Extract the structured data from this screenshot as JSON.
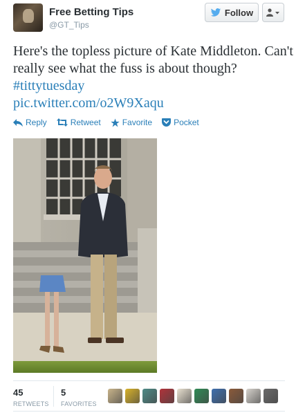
{
  "account": {
    "name": "Free Betting Tips",
    "handle": "@GT_Tips"
  },
  "header": {
    "follow_label": "Follow"
  },
  "tweet": {
    "text": "Here's the topless picture of Kate Middleton. Can't really see what the fuss is about though?",
    "hashtag": "#tittytuesday",
    "link": "pic.twitter.com/o2W9Xaqu"
  },
  "actions": {
    "reply": "Reply",
    "retweet": "Retweet",
    "favorite": "Favorite",
    "pocket": "Pocket"
  },
  "stats": {
    "retweets_count": "45",
    "retweets_label": "RETWEETS",
    "favorites_count": "5",
    "favorites_label": "FAVORITES"
  },
  "colors": {
    "link": "#2a7fb8",
    "twitter_blue": "#55acee",
    "muted": "#8899a6"
  },
  "favoriters": [
    {
      "icon": "favoriter-avatar-1",
      "color": "#c9b48a"
    },
    {
      "icon": "favoriter-avatar-2",
      "color": "#d8b22a"
    },
    {
      "icon": "favoriter-avatar-3",
      "color": "#4e8a86"
    },
    {
      "icon": "favoriter-avatar-4",
      "color": "#b0333a"
    },
    {
      "icon": "favoriter-avatar-5",
      "color": "#e8e0d0"
    },
    {
      "icon": "favoriter-avatar-6",
      "color": "#2f8a55"
    },
    {
      "icon": "favoriter-avatar-7",
      "color": "#3e6fae"
    },
    {
      "icon": "favoriter-avatar-8",
      "color": "#8a5a3a"
    },
    {
      "icon": "favoriter-avatar-9",
      "color": "#d6d2cc"
    },
    {
      "icon": "favoriter-avatar-10",
      "color": "#6a6a6a"
    }
  ]
}
